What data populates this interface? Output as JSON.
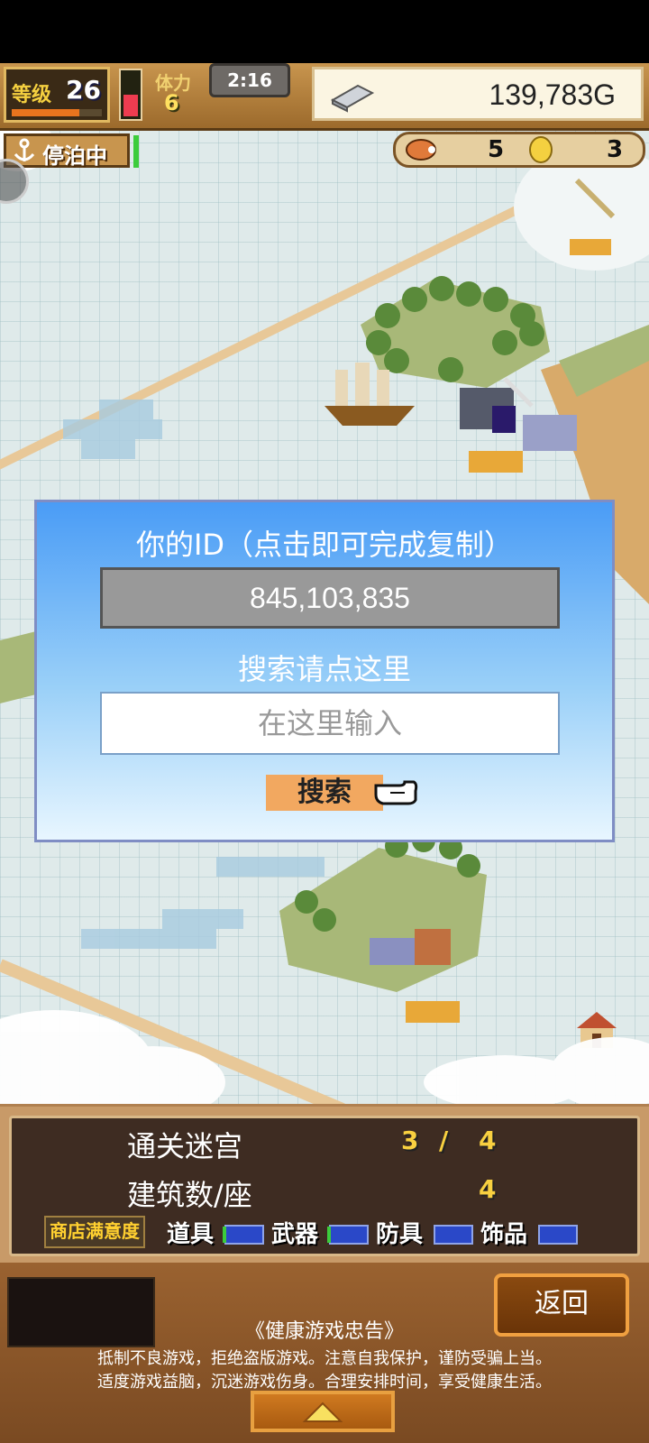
{
  "hud": {
    "level_label": "等级",
    "level": "26",
    "level_progress": 0.75,
    "stamina_label": "体力",
    "stamina": "6",
    "stamina_fill": 0.5,
    "timer": "2:16",
    "gold": "139,783G",
    "dock_status": "停泊中",
    "item_a_count": "5",
    "item_b_count": "3"
  },
  "dialog": {
    "title": "你的ID（点击即可完成复制）",
    "user_id": "845,103,835",
    "search_hint": "搜索请点这里",
    "input_placeholder": "在这里输入",
    "input_value": "",
    "search_button": "搜索"
  },
  "stats": {
    "dungeons_label": "通关迷宫",
    "dungeons_cleared": "3",
    "dungeons_sep": "/",
    "dungeons_total": "4",
    "buildings_label": "建筑数/座",
    "buildings_count": "4",
    "shop_satisfaction_label": "商店满意度",
    "categories": [
      {
        "label": "道具"
      },
      {
        "label": "武器"
      },
      {
        "label": "防具"
      },
      {
        "label": "饰品"
      }
    ]
  },
  "bottom": {
    "back_button": "返回",
    "notice_title": "《健康游戏忠告》",
    "notice_line1": "抵制不良游戏，拒绝盗版游戏。注意自我保护，谨防受骗上当。",
    "notice_line2": "适度游戏益脑，沉迷游戏伤身。合理安排时间，享受健康生活。"
  },
  "colors": {
    "dialog_top": "#4a9cf6",
    "gold_text": "#222222",
    "stat_value": "#f8d040",
    "button_orange": "#f2a860"
  }
}
